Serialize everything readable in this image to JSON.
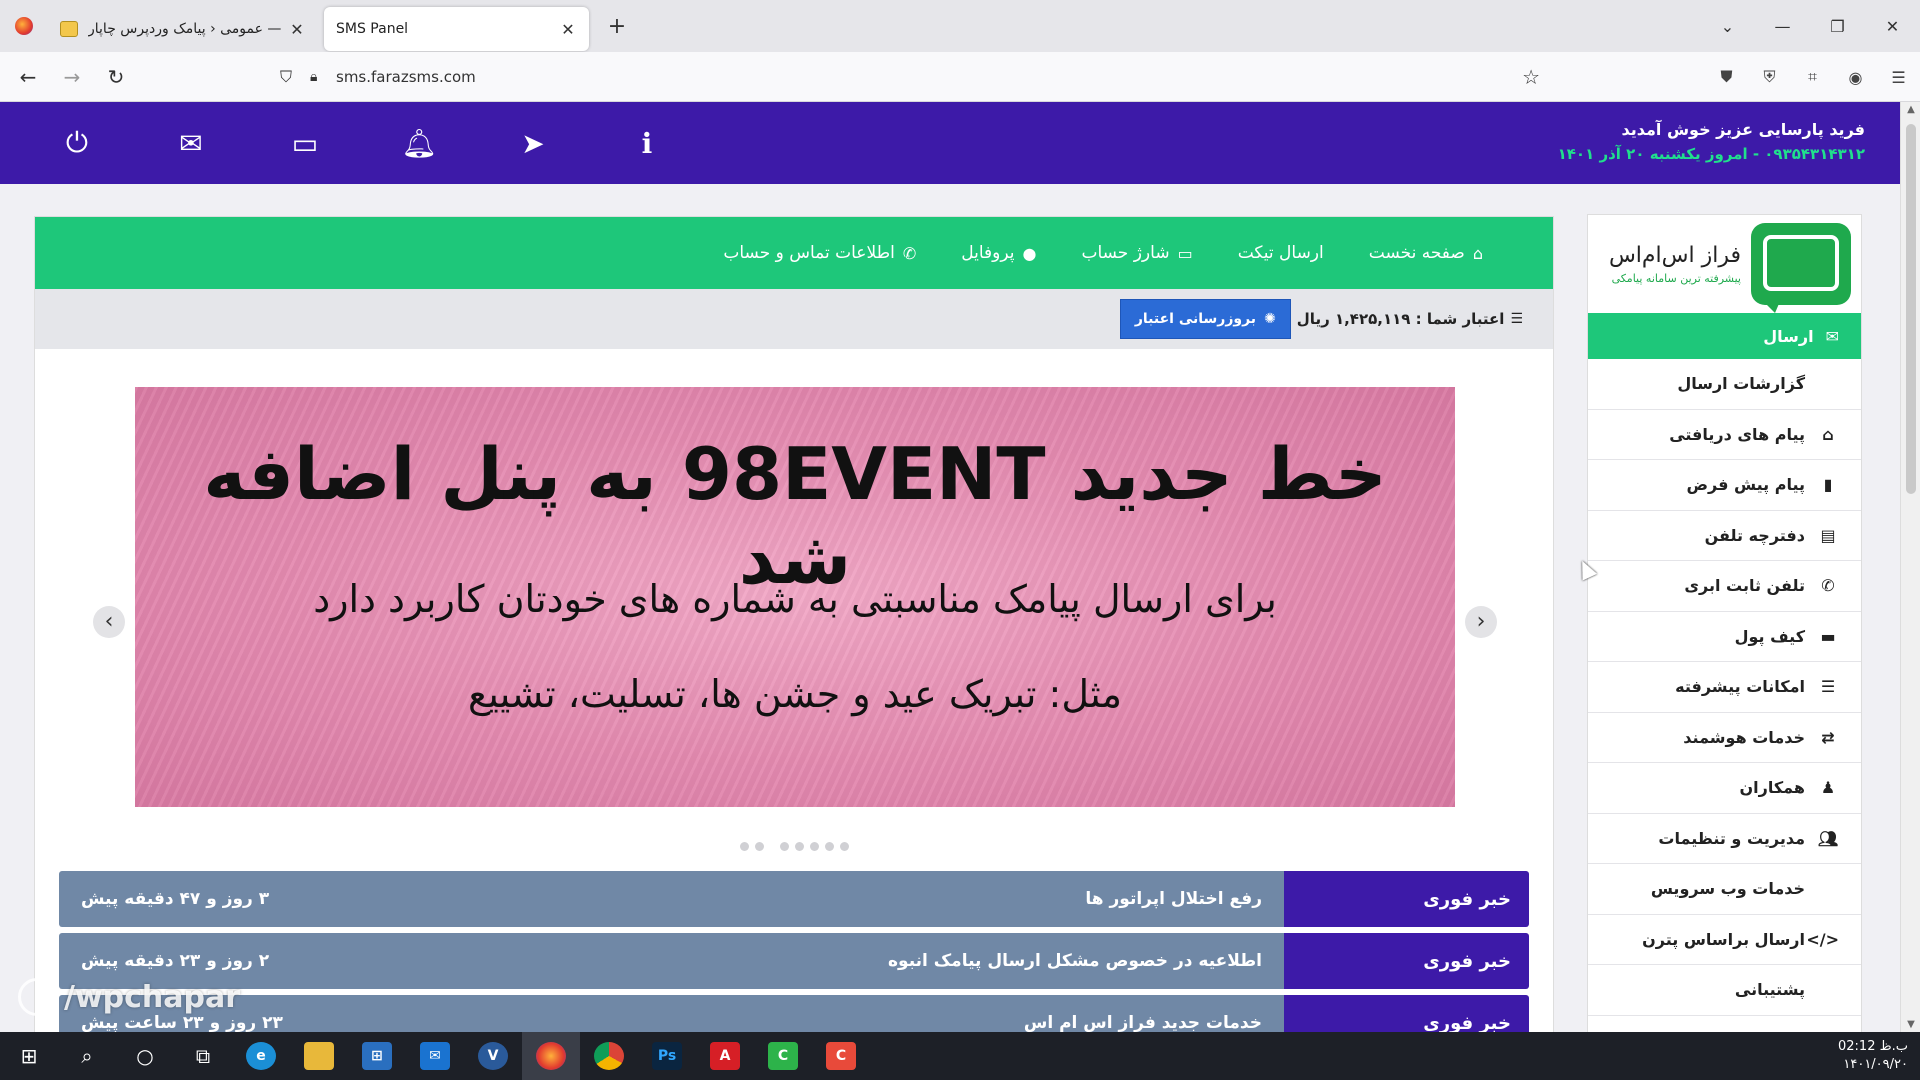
{
  "browser": {
    "tabs": [
      {
        "title": "عمومی ‹ پیامک وردپرس چاپار —"
      },
      {
        "title": "SMS Panel"
      }
    ],
    "url": "sms.farazsms.com"
  },
  "topbar": {
    "welcome": "فرید پارسایی عزیز خوش آمدید",
    "subline": "۰۹۳۵۴۳۱۴۳۱۲ - امروز یکشنبه ۲۰ آذر ۱۴۰۱"
  },
  "logo": {
    "name": "فراز اس‌ام‌اس",
    "tagline": "پیشرفته ترین سامانه پیامکی"
  },
  "sidebar": {
    "send": "ارسال",
    "items": [
      {
        "label": "گزارشات ارسال",
        "icon": ""
      },
      {
        "label": "پیام های دریافتی",
        "icon": "inbox-icon"
      },
      {
        "label": "پیام پیش فرض",
        "icon": "bookmark-icon"
      },
      {
        "label": "دفترچه تلفن",
        "icon": "book-icon"
      },
      {
        "label": "تلفن ثابت ابری",
        "icon": "phone-icon"
      },
      {
        "label": "کیف پول",
        "icon": "wallet-icon"
      },
      {
        "label": "امکانات پیشرفته",
        "icon": "list-icon"
      },
      {
        "label": "خدمات هوشمند",
        "icon": "retweet-icon"
      },
      {
        "label": "همکاران",
        "icon": "user-tie-icon"
      },
      {
        "label": "مدیریت و تنظیمات",
        "icon": "users-icon"
      },
      {
        "label": "خدمات وب سرویس",
        "icon": ""
      },
      {
        "label": "ارسال براساس پترن",
        "icon": "code-icon"
      },
      {
        "label": "پشتیبانی",
        "icon": ""
      }
    ]
  },
  "menu": {
    "home": "صفحه نخست",
    "ticket": "ارسال تیکت",
    "charge": "شارژ حساب",
    "profile": "پروفایل",
    "contact": "اطلاعات تماس و حساب"
  },
  "credit": {
    "label": "اعتبار شما : ۱,۴۲۵,۱۱۹ ریال",
    "refresh": "بروزرسانی اعتبار"
  },
  "slide": {
    "headline": "خط جدید 98EVENT به پنل اضافه شد",
    "line2": "برای ارسال پیامک مناسبتی به شماره های خودتان کاربرد دارد",
    "line3": "مثل: تبریک عید و جشن ها، تسلیت، تشییع"
  },
  "news": [
    {
      "tag": "خبر فوری",
      "title": "رفع اختلال اپراتور ها",
      "time": "۳ روز و ۴۷ دقیقه پیش"
    },
    {
      "tag": "خبر فوری",
      "title": "اطلاعیه در خصوص مشکل ارسال پیامک انبوه",
      "time": "۲ روز و ۲۳ دقیقه پیش"
    },
    {
      "tag": "خبر فوری",
      "title": "خدمات جدید فراز اس ام اس",
      "time": "۲۳ روز و ۲۳ ساعت پیش"
    }
  ],
  "watermark": "/wpchapar",
  "clock": {
    "time": "ب.ظ 02:12",
    "date": "۱۴۰۱/۰۹/۲۰"
  },
  "colors": {
    "brand_purple": "#3d1aa8",
    "brand_green": "#1ec77a",
    "refresh_blue": "#2b6bd6",
    "news_body": "#7088a6"
  }
}
